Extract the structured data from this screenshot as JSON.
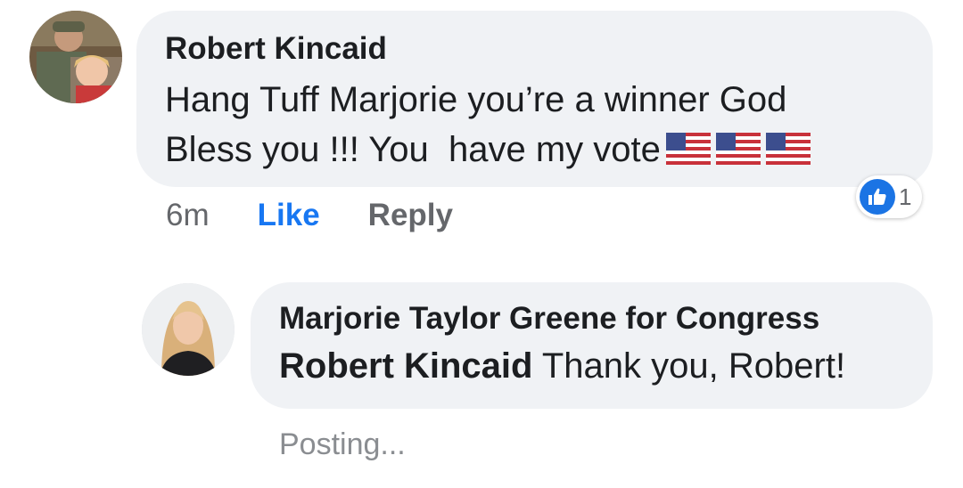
{
  "comment": {
    "author": "Robert Kincaid",
    "text_line_1": "Hang Tuff Marjorie you’re a winner God",
    "text_line_2": "Bless you !!! You  have my vote",
    "emoji": [
      "us-flag-emoji",
      "us-flag-emoji",
      "us-flag-emoji"
    ],
    "timestamp": "6m",
    "like_label": "Like",
    "reply_label": "Reply",
    "reaction": {
      "icon": "thumbs-up-icon",
      "count": "1",
      "color": "#1b74e4"
    }
  },
  "reply": {
    "author": "Marjorie Taylor Greene for Congress",
    "mention": "Robert Kincaid",
    "text": " Thank you, Robert!",
    "status": "Posting..."
  },
  "colors": {
    "bubble": "#f0f2f5",
    "text": "#1c1e21",
    "secondary_text": "#65676b",
    "link_blue": "#1877f2"
  }
}
